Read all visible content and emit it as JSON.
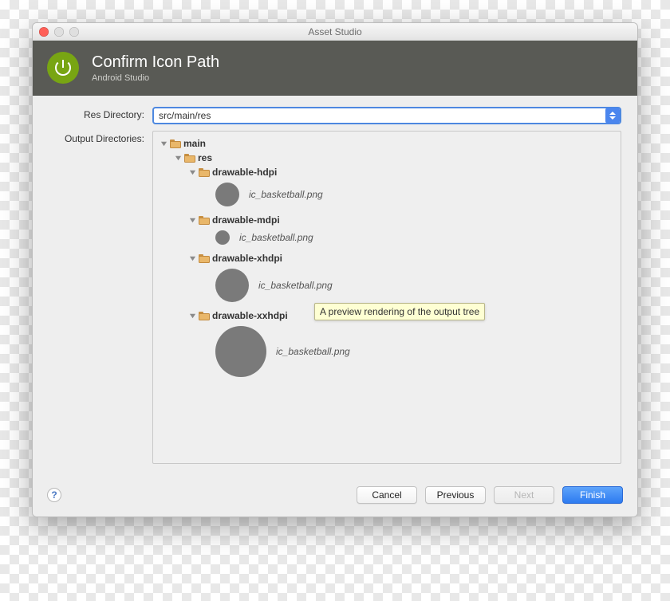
{
  "window": {
    "title": "Asset Studio"
  },
  "header": {
    "title": "Confirm Icon Path",
    "subtitle": "Android Studio"
  },
  "fields": {
    "res_dir_label": "Res Directory:",
    "res_dir_value": "src/main/res",
    "output_dirs_label": "Output Directories:"
  },
  "tree": {
    "root": {
      "label": "main"
    },
    "res": {
      "label": "res"
    },
    "densities": [
      {
        "folder": "drawable-hdpi",
        "file": "ic_basketball.png",
        "size": 30
      },
      {
        "folder": "drawable-mdpi",
        "file": "ic_basketball.png",
        "size": 18
      },
      {
        "folder": "drawable-xhdpi",
        "file": "ic_basketball.png",
        "size": 42
      },
      {
        "folder": "drawable-xxhdpi",
        "file": "ic_basketball.png",
        "size": 64
      }
    ]
  },
  "tooltip": "A preview rendering of the output tree",
  "buttons": {
    "cancel": "Cancel",
    "previous": "Previous",
    "next": "Next",
    "finish": "Finish"
  }
}
